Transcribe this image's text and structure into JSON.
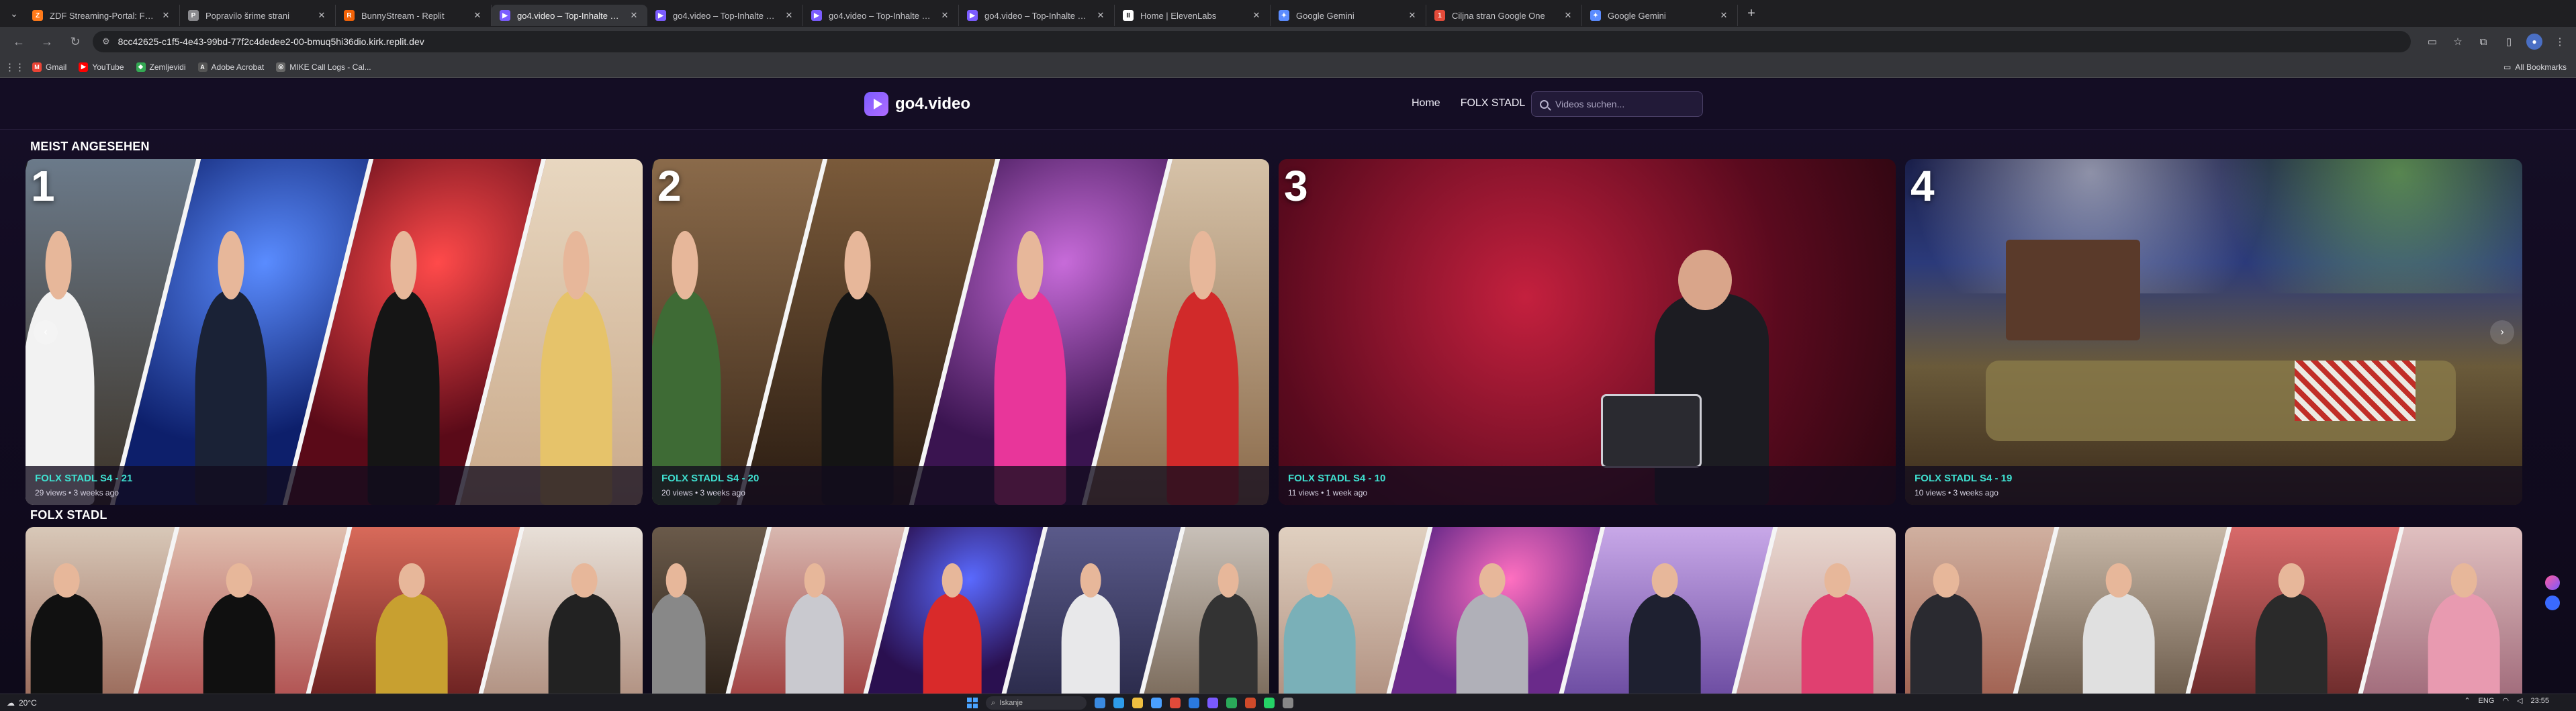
{
  "browser": {
    "tabs": [
      {
        "label": "ZDF Streaming-Portal: Filme, Se...",
        "favicon_color": "#ff7a1a",
        "favicon_glyph": "Z",
        "active": false
      },
      {
        "label": "Popravilo šrime strani",
        "favicon_color": "#8a8a8e",
        "favicon_glyph": "P",
        "active": false
      },
      {
        "label": "BunnyStream - Replit",
        "favicon_color": "#f26207",
        "favicon_glyph": "R",
        "active": false
      },
      {
        "label": "go4.video – Top-Inhalte von Fo...",
        "favicon_color": "#7b5cff",
        "favicon_glyph": "▶",
        "active": true
      },
      {
        "label": "go4.video – Top-Inhalte von Fo...",
        "favicon_color": "#7b5cff",
        "favicon_glyph": "▶",
        "active": false
      },
      {
        "label": "go4.video – Top-Inhalte von Fo...",
        "favicon_color": "#7b5cff",
        "favicon_glyph": "▶",
        "active": false
      },
      {
        "label": "go4.video – Top-Inhalte von Fo...",
        "favicon_color": "#7b5cff",
        "favicon_glyph": "▶",
        "active": false
      },
      {
        "label": "Home | ElevenLabs",
        "favicon_color": "#ffffff",
        "favicon_glyph": "II",
        "active": false
      },
      {
        "label": "Google Gemini",
        "favicon_color": "#5b8cff",
        "favicon_glyph": "✦",
        "active": false
      },
      {
        "label": "Ciljna stran Google One",
        "favicon_color": "#e44b3a",
        "favicon_glyph": "1",
        "active": false
      },
      {
        "label": "Google Gemini",
        "favicon_color": "#5b8cff",
        "favicon_glyph": "✦",
        "active": false
      }
    ],
    "url": "8cc42625-c1f5-4e43-99bd-77f2c4dedee2-00-bmuq5hi36dio.kirk.replit.dev",
    "bookmarks": [
      {
        "label": "Gmail",
        "color": "#ea4335",
        "glyph": "M"
      },
      {
        "label": "YouTube",
        "color": "#ff0000",
        "glyph": "▶"
      },
      {
        "label": "Zemljevidi",
        "color": "#34a853",
        "glyph": "◆"
      },
      {
        "label": "Adobe Acrobat",
        "color": "#555555",
        "glyph": "A"
      },
      {
        "label": "MIKE Call Logs - Cal...",
        "color": "#666666",
        "glyph": "◎"
      }
    ],
    "all_bookmarks": "All Bookmarks"
  },
  "site": {
    "logo_text": "go4.video",
    "nav": [
      "Home",
      "FOLX STADL"
    ],
    "search_placeholder": "Videos suchen...",
    "sections": {
      "top": "MEIST ANGESEHEN",
      "folx": "FOLX STADL"
    },
    "top_cards": [
      {
        "rank": "1",
        "title": "FOLX STADL S4 - 21",
        "meta": "29 views • 3 weeks ago"
      },
      {
        "rank": "2",
        "title": "FOLX STADL S4 - 20",
        "meta": "20 views • 3 weeks ago"
      },
      {
        "rank": "3",
        "title": "FOLX STADL S4 - 10",
        "meta": "11 views • 1 week ago"
      },
      {
        "rank": "4",
        "title": "FOLX STADL S4 - 19",
        "meta": "10 views • 3 weeks ago"
      }
    ]
  },
  "taskbar": {
    "weather": "20°C",
    "search_label": "Iskanje",
    "language": "ENG",
    "time": "23:55"
  }
}
